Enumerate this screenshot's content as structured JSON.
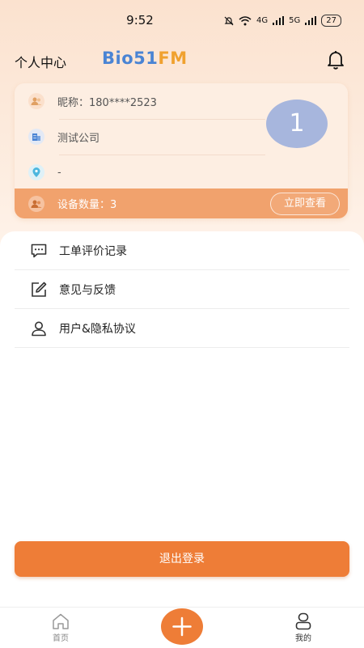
{
  "status_bar": {
    "time": "9:52",
    "net1": "4G",
    "net2": "5G",
    "battery": "27"
  },
  "header": {
    "title": "个人中心",
    "logo_part1": "Bio51",
    "logo_part2": "FM"
  },
  "profile": {
    "nickname": "昵称：180****2523",
    "company": "测试公司",
    "location": "-",
    "avatar_text": "1",
    "device_count": "设备数量：3",
    "view_button": "立即查看"
  },
  "menu": [
    {
      "label": "工单评价记录",
      "icon": "comment-icon"
    },
    {
      "label": "意见与反馈",
      "icon": "edit-icon"
    },
    {
      "label": "用户&隐私协议",
      "icon": "user-icon"
    }
  ],
  "logout_label": "退出登录",
  "tabbar": {
    "home": "首页",
    "me": "我的"
  },
  "colors": {
    "accent": "#ee7d37",
    "card_bg": "#fdeee2",
    "device_bar": "#f1a26d",
    "avatar": "#a7b6dd"
  }
}
